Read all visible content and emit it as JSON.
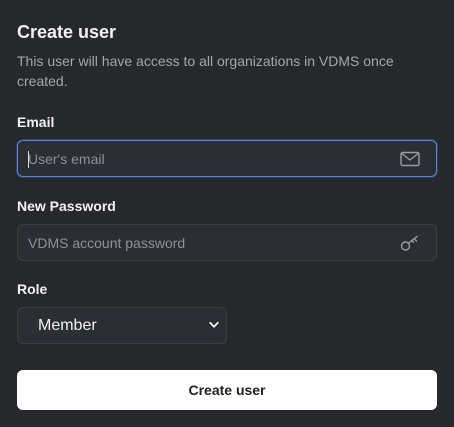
{
  "form": {
    "title": "Create user",
    "description": "This user will have access to all organizations in VDMS once created.",
    "email": {
      "label": "Email",
      "placeholder": "User's email",
      "value": "",
      "icon": "envelope-icon"
    },
    "password": {
      "label": "New Password",
      "placeholder": "VDMS account password",
      "value": "",
      "icon": "key-icon"
    },
    "role": {
      "label": "Role",
      "selected": "Member",
      "icon": "chevron-down-icon"
    },
    "submit_label": "Create user"
  },
  "colors": {
    "background": "#27282c",
    "input_background": "#2d2e33",
    "focus_ring": "#4e86e6",
    "button_background": "#ffffff"
  }
}
